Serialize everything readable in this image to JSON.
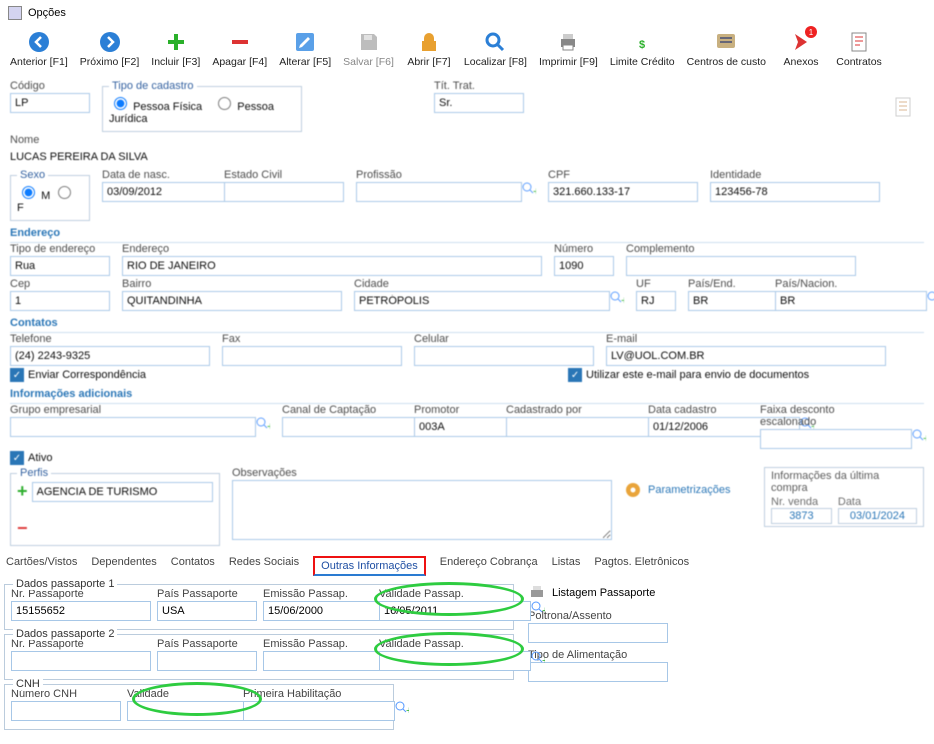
{
  "window": {
    "title": "Opções"
  },
  "toolbar": {
    "prev": "Anterior [F1]",
    "next": "Próximo [F2]",
    "incl": "Incluir [F3]",
    "del": "Apagar [F4]",
    "alt": "Alterar [F5]",
    "save": "Salvar [F6]",
    "open": "Abrir [F7]",
    "find": "Localizar [F8]",
    "print": "Imprimir [F9]",
    "limit": "Limite Crédito",
    "cc": "Centros de custo",
    "anx": "Anexos",
    "anx_badge": "1",
    "contr": "Contratos"
  },
  "fields": {
    "codigo_l": "Código",
    "codigo_v": "LP",
    "tipocad_l": "Tipo de cadastro",
    "tipocad_f": "Pessoa Física",
    "tipocad_j": "Pessoa Jurídica",
    "tittrat_l": "Tít. Trat.",
    "tittrat_v": "Sr.",
    "nome_l": "Nome",
    "nome_v": "LUCAS PEREIRA DA SILVA",
    "sexo_l": "Sexo",
    "sexo_m": "M",
    "sexo_f": "F",
    "nasc_l": "Data de nasc.",
    "nasc_v": "03/09/2012",
    "estciv_l": "Estado Civil",
    "prof_l": "Profissão",
    "cpf_l": "CPF",
    "cpf_v": "321.660.133-17",
    "ident_l": "Identidade",
    "ident_v": "123456-78"
  },
  "endereco": {
    "title": "Endereço",
    "tipo_l": "Tipo de endereço",
    "tipo_v": "Rua",
    "end_l": "Endereço",
    "end_v": "RIO DE JANEIRO",
    "num_l": "Número",
    "num_v": "1090",
    "compl_l": "Complemento",
    "cep_l": "Cep",
    "cep_v": "1",
    "bairro_l": "Bairro",
    "bairro_v": "QUITANDINHA",
    "cidade_l": "Cidade",
    "cidade_v": "PETRÓPOLIS",
    "uf_l": "UF",
    "uf_v": "RJ",
    "paisend_l": "País/End.",
    "paisend_v": "BR",
    "paisnac_l": "País/Nacion.",
    "paisnac_v": "BR"
  },
  "contatos": {
    "title": "Contatos",
    "tel_l": "Telefone",
    "tel_v": "(24) 2243-9325",
    "fax_l": "Fax",
    "cel_l": "Celular",
    "email_l": "E-mail",
    "email_v": "LV@UOL.COM.BR",
    "corr": "Enviar Correspondência",
    "docmail": "Utilizar este e-mail para envio de documentos"
  },
  "adic": {
    "title": "Informações adicionais",
    "grp_l": "Grupo empresarial",
    "canal_l": "Canal de Captação",
    "prom_l": "Promotor",
    "prom_v": "003A",
    "cadpor_l": "Cadastrado por",
    "dtcad_l": "Data cadastro",
    "dtcad_v": "01/12/2006",
    "faixa_l": "Faixa desconto escalonado",
    "ativo": "Ativo",
    "perfis_l": "Perfis",
    "perfis_v": "AGENCIA DE TURISMO",
    "obs_l": "Observações",
    "param": "Parametrizações",
    "ult_title": "Informações da última compra",
    "ult_nr_l": "Nr. venda",
    "ult_nr_v": "3873",
    "ult_dt_l": "Data",
    "ult_dt_v": "03/01/2024"
  },
  "tabs": {
    "cart": "Cartões/Vistos",
    "dep": "Dependentes",
    "cont": "Contatos",
    "redes": "Redes Sociais",
    "outras": "Outras Informações",
    "endcob": "Endereço Cobrança",
    "listas": "Listas",
    "pagto": "Pagtos. Eletrônicos"
  },
  "passaporte": {
    "p1_title": "Dados passaporte 1",
    "p2_title": "Dados passaporte 2",
    "nr_l": "Nr. Passaporte",
    "pais_l": "País Passaporte",
    "emis_l": "Emissão Passap.",
    "val_l": "Validade Passap.",
    "p1_nr": "15155652",
    "p1_pais": "USA",
    "p1_emis": "15/06/2000",
    "p1_val": "16/05/2011",
    "listagem": "Listagem Passaporte",
    "poltrona_l": "Poltrona/Assento",
    "alim_l": "Tipo de Alimentação"
  },
  "cnh": {
    "title": "CNH",
    "num_l": "Número CNH",
    "val_l": "Validade",
    "prim_l": "Primeira Habilitação"
  }
}
